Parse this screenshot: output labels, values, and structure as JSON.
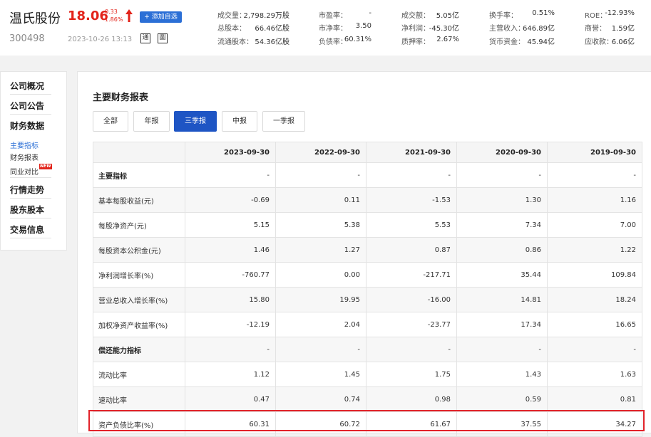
{
  "stock": {
    "name": "温氏股份",
    "code": "300498",
    "price": "18.06",
    "change_abs": "0.33",
    "change_pct": "1.86%",
    "datetime": "2023-10-26 13:13",
    "add_watch_label": "+ 添加自选",
    "icon_label_1": "通",
    "icon_label_2": "圖",
    "up_color": "#e2231a"
  },
  "stats": [
    {
      "label": "成交量：",
      "value": "2,798.29万股"
    },
    {
      "label": "市盈率：",
      "value": "-"
    },
    {
      "label": "成交额：",
      "value": "5.05亿"
    },
    {
      "label": "换手率：",
      "value": "0.51%"
    },
    {
      "label": "ROE：",
      "value": "-12.93%"
    },
    {
      "label": "总股本：",
      "value": "66.46亿股"
    },
    {
      "label": "市净率：",
      "value": "3.50"
    },
    {
      "label": "净利润：",
      "value": "-45.30亿"
    },
    {
      "label": "主营收入：",
      "value": "646.89亿"
    },
    {
      "label": "商誉：",
      "value": "1.59亿"
    },
    {
      "label": "流通股本：",
      "value": "54.36亿股"
    },
    {
      "label": "负债率：",
      "value": "60.31%"
    },
    {
      "label": "质押率：",
      "value": "2.67%"
    },
    {
      "label": "货币资金：",
      "value": "45.94亿"
    },
    {
      "label": "应收款：",
      "value": "6.06亿"
    }
  ],
  "nav": {
    "items": [
      "公司概况",
      "公司公告",
      "财务数据"
    ],
    "sub_items": [
      "主要指标",
      "财务报表",
      "同业对比"
    ],
    "new_badge": "NEW",
    "items2": [
      "行情走势",
      "股东股本",
      "交易信息"
    ],
    "active_color": "#2b6fd6"
  },
  "main": {
    "title": "主要财务报表",
    "tabs": [
      "全部",
      "年报",
      "三季报",
      "中报",
      "一季报"
    ],
    "active_tab": "三季报",
    "columns": [
      "",
      "2023-09-30",
      "2022-09-30",
      "2021-09-30",
      "2020-09-30",
      "2019-09-30"
    ],
    "rows": [
      {
        "label": "主要指标",
        "values": [
          "-",
          "-",
          "-",
          "-",
          "-"
        ],
        "section": true
      },
      {
        "label": "基本每股收益(元)",
        "values": [
          "-0.69",
          "0.11",
          "-1.53",
          "1.30",
          "1.16"
        ]
      },
      {
        "label": "每股净资产(元)",
        "values": [
          "5.15",
          "5.38",
          "5.53",
          "7.34",
          "7.00"
        ]
      },
      {
        "label": "每股资本公积金(元)",
        "values": [
          "1.46",
          "1.27",
          "0.87",
          "0.86",
          "1.22"
        ]
      },
      {
        "label": "净利润增长率(%)",
        "values": [
          "-760.77",
          "0.00",
          "-217.71",
          "35.44",
          "109.84"
        ]
      },
      {
        "label": "营业总收入增长率(%)",
        "values": [
          "15.80",
          "19.95",
          "-16.00",
          "14.81",
          "18.24"
        ]
      },
      {
        "label": "加权净资产收益率(%)",
        "values": [
          "-12.19",
          "2.04",
          "-23.77",
          "17.34",
          "16.65"
        ]
      },
      {
        "label": "偿还能力指标",
        "values": [
          "-",
          "-",
          "-",
          "-",
          "-"
        ],
        "section": true
      },
      {
        "label": "流动比率",
        "values": [
          "1.12",
          "1.45",
          "1.75",
          "1.43",
          "1.63"
        ]
      },
      {
        "label": "速动比率",
        "values": [
          "0.47",
          "0.74",
          "0.98",
          "0.59",
          "0.81"
        ]
      },
      {
        "label": "资产负债比率(%)",
        "values": [
          "60.31",
          "60.72",
          "61.67",
          "37.55",
          "34.27"
        ],
        "highlighted": true
      }
    ],
    "highlight_color": "#e2232a"
  }
}
